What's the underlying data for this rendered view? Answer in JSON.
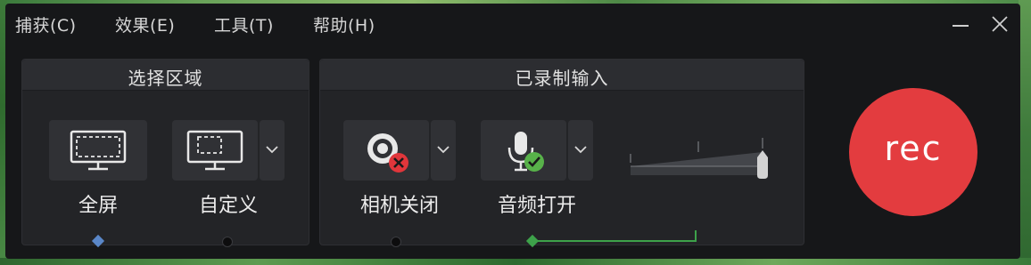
{
  "menu": {
    "capture": "捕获(C)",
    "effects": "效果(E)",
    "tools": "工具(T)",
    "help": "帮助(H)"
  },
  "select_area": {
    "title": "选择区域",
    "fullscreen_label": "全屏",
    "custom_label": "自定义",
    "selected": "fullscreen"
  },
  "recorded_input": {
    "title": "已录制输入",
    "camera_label": "相机关闭",
    "camera_state": "off",
    "audio_label": "音频打开",
    "audio_state": "on"
  },
  "rec_button": {
    "label": "rec"
  },
  "colors": {
    "rec_red": "#e33c3f",
    "camera_off_red": "#e0363b",
    "audio_on_green": "#58b24a",
    "selected_blue": "#5a87c8",
    "connector_green": "#3da24a"
  },
  "icons": {
    "fullscreen": "monitor-dashed-full-icon",
    "custom": "monitor-dashed-region-icon",
    "camera": "webcam-icon",
    "camera_status": "x-circle-icon",
    "audio": "microphone-icon",
    "audio_status": "check-circle-icon",
    "dropdown": "chevron-down-icon"
  }
}
